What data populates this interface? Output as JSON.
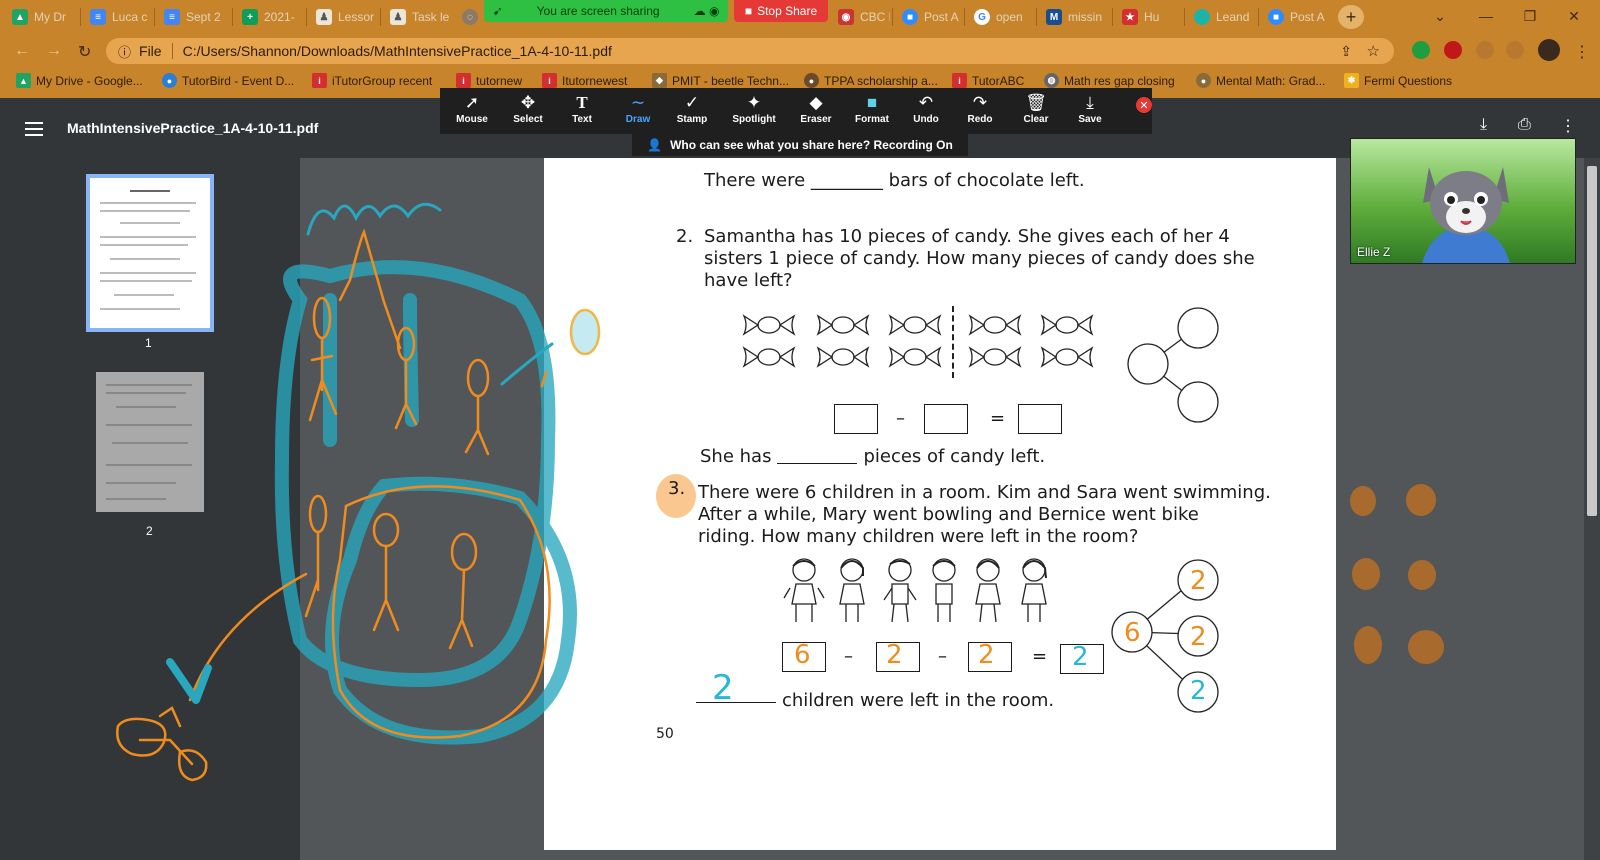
{
  "tabs": [
    {
      "label": "My Dr",
      "icon": "google-drive-icon",
      "color": "#1fa463"
    },
    {
      "label": "Luca c",
      "icon": "google-docs-icon",
      "color": "#4285f4"
    },
    {
      "label": "Sept 2",
      "icon": "google-docs-icon",
      "color": "#4285f4"
    },
    {
      "label": "2021-",
      "icon": "google-sheets-icon",
      "color": "#0f9d58"
    },
    {
      "label": "Lessor",
      "icon": "lesson-icon",
      "color": "#7a6a55"
    },
    {
      "label": "Task le",
      "icon": "task-icon",
      "color": "#7a6a55"
    },
    {
      "label": "CBC N",
      "icon": "cbc-icon",
      "color": "#cc3333"
    },
    {
      "label": "Post A",
      "icon": "zoom-icon",
      "color": "#2d8cff"
    },
    {
      "label": "open",
      "icon": "google-icon",
      "color": "#ffffff"
    },
    {
      "label": "missin",
      "icon": "merriam-webster-icon",
      "color": "#1a4d8f"
    },
    {
      "label": "Hu",
      "icon": "star-icon",
      "color": "#d32f2f"
    },
    {
      "label": "Leand",
      "icon": "leand-icon",
      "color": "#1bb5a8"
    },
    {
      "label": "Post A",
      "icon": "zoom-icon",
      "color": "#2d8cff"
    }
  ],
  "share_banner": {
    "label": "You are screen sharing",
    "stop_label": "Stop Share"
  },
  "address": {
    "file_label": "File",
    "url": "C:/Users/Shannon/Downloads/MathIntensivePractice_1A-4-10-11.pdf"
  },
  "bookmarks": [
    {
      "label": "My Drive - Google...",
      "color": "#1fa463"
    },
    {
      "label": "TutorBird - Event D...",
      "color": "#2a7fd4"
    },
    {
      "label": "iTutorGroup recent",
      "color": "#d32f2f"
    },
    {
      "label": "tutornew",
      "color": "#d32f2f"
    },
    {
      "label": "Itutornewest",
      "color": "#d32f2f"
    },
    {
      "label": "PMIT - beetle Techn...",
      "color": "#8a6a3a"
    },
    {
      "label": "TPPA scholarship a...",
      "color": "#6a4a2a"
    },
    {
      "label": "TutorABC",
      "color": "#d32f2f"
    },
    {
      "label": "Math res gap closing",
      "color": "#666666"
    },
    {
      "label": "Mental Math: Grad...",
      "color": "#8a6a3a"
    },
    {
      "label": "Fermi Questions",
      "color": "#f0b020"
    }
  ],
  "pdf": {
    "title": "MathIntensivePractice_1A-4-10-11.pdf"
  },
  "annotate_tools": [
    {
      "label": "Mouse",
      "icon": "mouse-pointer-icon",
      "glyph": "➚"
    },
    {
      "label": "Select",
      "icon": "move-icon",
      "glyph": "✥"
    },
    {
      "label": "Text",
      "icon": "text-icon",
      "glyph": "T"
    },
    {
      "label": "Draw",
      "icon": "draw-icon",
      "glyph": "∼"
    },
    {
      "label": "Stamp",
      "icon": "checkmark-icon",
      "glyph": "✓"
    },
    {
      "label": "Spotlight",
      "icon": "spotlight-icon",
      "glyph": "✦"
    },
    {
      "label": "Eraser",
      "icon": "eraser-icon",
      "glyph": "◆"
    },
    {
      "label": "Format",
      "icon": "format-icon",
      "glyph": "■"
    },
    {
      "label": "Undo",
      "icon": "undo-icon",
      "glyph": "↶"
    },
    {
      "label": "Redo",
      "icon": "redo-icon",
      "glyph": "↷"
    },
    {
      "label": "Clear",
      "icon": "trash-icon",
      "glyph": "🗑"
    },
    {
      "label": "Save",
      "icon": "save-icon",
      "glyph": "⤓"
    }
  ],
  "recording_info": "Who can see what you share here? Recording On",
  "thumbnails": [
    {
      "page": "1"
    },
    {
      "page": "2"
    }
  ],
  "worksheet": {
    "line_top": "There were ________ bars of chocolate left.",
    "q2_num": "2.",
    "q2_line1": "Samantha has 10 pieces of candy. She gives each of her 4",
    "q2_line2": "sisters 1 piece of candy. How many pieces of candy does she",
    "q2_line3": "have left?",
    "minus": "–",
    "equals": "=",
    "q2_answer_pre": "She has",
    "q2_answer_post": "pieces of candy left.",
    "q3_num": "3.",
    "q3_line1": "There were 6 children in a room. Kim and Sara went swimming.",
    "q3_line2": "After a while, Mary went bowling and Bernice went bike",
    "q3_line3": "riding. How many children were left in the room?",
    "q3_box1": "6",
    "q3_box2": "2",
    "q3_box3": "2",
    "q3_box4": "2",
    "q3_bond_whole": "6",
    "q3_bond_part1": "2",
    "q3_bond_part2": "2",
    "q3_bond_part3": "2",
    "q3_answer_hand": "2",
    "q3_answer_post": "children were left in the room.",
    "page_number": "50"
  },
  "video": {
    "name": "Ellie Z"
  },
  "colors": {
    "tabbar": "#c8842b",
    "ink_orange": "#f08c1e",
    "ink_teal": "#28a7bf",
    "share_green": "#2ec042",
    "stop_red": "#e53935"
  }
}
